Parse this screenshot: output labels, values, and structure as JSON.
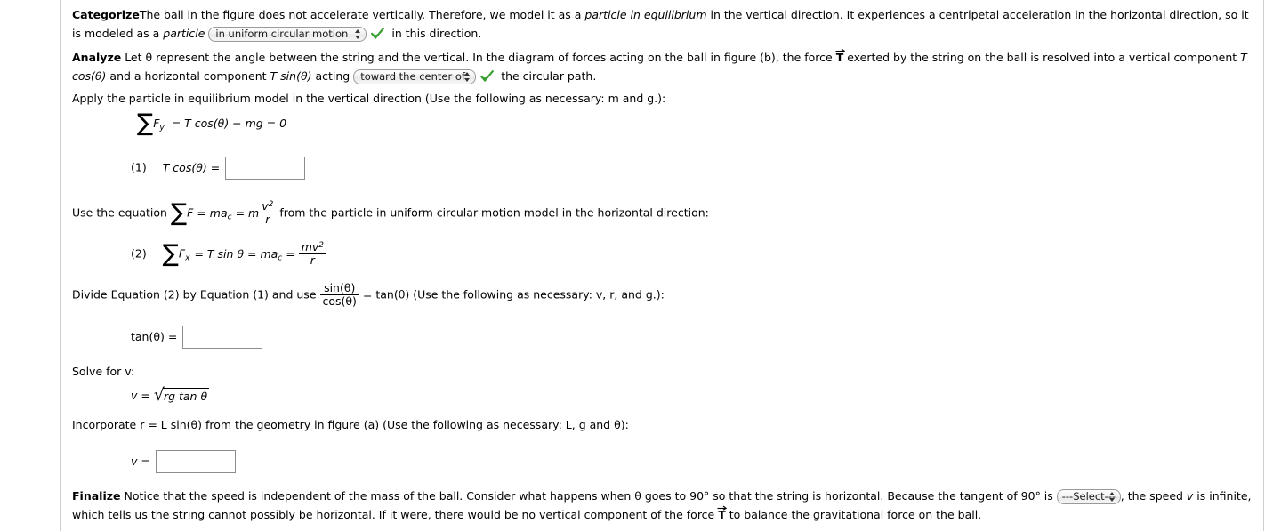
{
  "page": {
    "background": "#ffffff",
    "rule_color": "#cfcfcf",
    "check_color": "#3a9e33",
    "input_border": "#8c8c8c"
  },
  "categorize": {
    "heading": "Categorize",
    "text_before": "The ball in the figure does not accelerate vertically. Therefore, we model it as a ",
    "italic_1": "particle in equilibrium",
    "text_mid": " in the vertical direction. It experiences a centripetal acceleration in the horizontal direction, so it is modeled as a ",
    "italic_2": "particle",
    "select": {
      "name": "categorize-model-select",
      "value": "in uniform circular motion",
      "status": "correct"
    },
    "text_after": "in this direction."
  },
  "analyze": {
    "heading": "Analyze",
    "text_1": "Let θ represent the angle between the string and the vertical. In the diagram of forces acting on the ball in figure (b), the force ",
    "vector_symbol": "T",
    "text_2": " exerted by the string on the ball is resolved into a vertical component ",
    "component_vertical": "T cos(θ)",
    "text_3": " and a horizontal component ",
    "component_horizontal": "T sin(θ)",
    "text_4": " acting ",
    "select": {
      "name": "analyze-direction-select",
      "value": "toward the center of",
      "status": "correct"
    },
    "text_5": "the circular path."
  },
  "apply": {
    "prompt": "Apply the particle in equilibrium model in the vertical direction (Use the following as necessary: m and g.):",
    "equation": {
      "sum": "∑",
      "sum_sub": "y",
      "sum_var": "F",
      "rest": "= T cos(θ) − mg = 0"
    },
    "answer_row": {
      "number": "(1)",
      "label": "T cos(θ) =",
      "input_name": "tcos-theta-input",
      "input_value": ""
    }
  },
  "use_equation": {
    "prefix": "Use the equation ",
    "sum": "∑",
    "sum_var": "F",
    "mid": "= ma",
    "mid_sub": "c",
    "eq2": "= m",
    "frac_num": "v",
    "frac_num_sup": "2",
    "frac_den": "r",
    "suffix": " from the particle in uniform circular motion model in the horizontal direction:",
    "equation2": {
      "number": "(2)",
      "sum": "∑",
      "sum_var": "F",
      "sum_sub": "x",
      "part1": "= T sin θ = ma",
      "part1_sub": "c",
      "equals": "=",
      "frac_num": "mv",
      "frac_num_sup": "2",
      "frac_den": "r"
    }
  },
  "divide": {
    "text_1": "Divide Equation (2) by Equation (1) and use ",
    "frac_num": "sin(θ)",
    "frac_den": "cos(θ)",
    "text_2": " = tan(θ) (Use the following as necessary: v, r, and g.):",
    "answer_row": {
      "label": "tan(θ) =",
      "input_name": "tan-theta-input",
      "input_value": ""
    }
  },
  "solve": {
    "prompt": "Solve for v:",
    "equation": {
      "lhs": "v = ",
      "radical": "√",
      "radicand": "rg tan θ"
    }
  },
  "incorporate": {
    "prompt": "Incorporate r = L sin(θ) from the geometry in figure (a) (Use the following as necessary: L, g and θ):",
    "answer_row": {
      "label": "v =",
      "input_name": "v-input",
      "input_value": ""
    }
  },
  "finalize": {
    "heading": "Finalize",
    "text_1": "Notice that the speed is independent of the mass of the ball. Consider what happens when θ goes to 90° so that the string is horizontal. Because the tangent of 90° is ",
    "select": {
      "name": "finalize-tangent-select",
      "value": "---Select---",
      "status": "unanswered"
    },
    "text_2": ", the speed ",
    "italic_v": "v",
    "text_3": " is infinite, which tells us the string cannot possibly be horizontal. If it were, there would be no vertical component of the force ",
    "vector_symbol": "T",
    "text_4": " to balance the gravitational force on the ball."
  }
}
